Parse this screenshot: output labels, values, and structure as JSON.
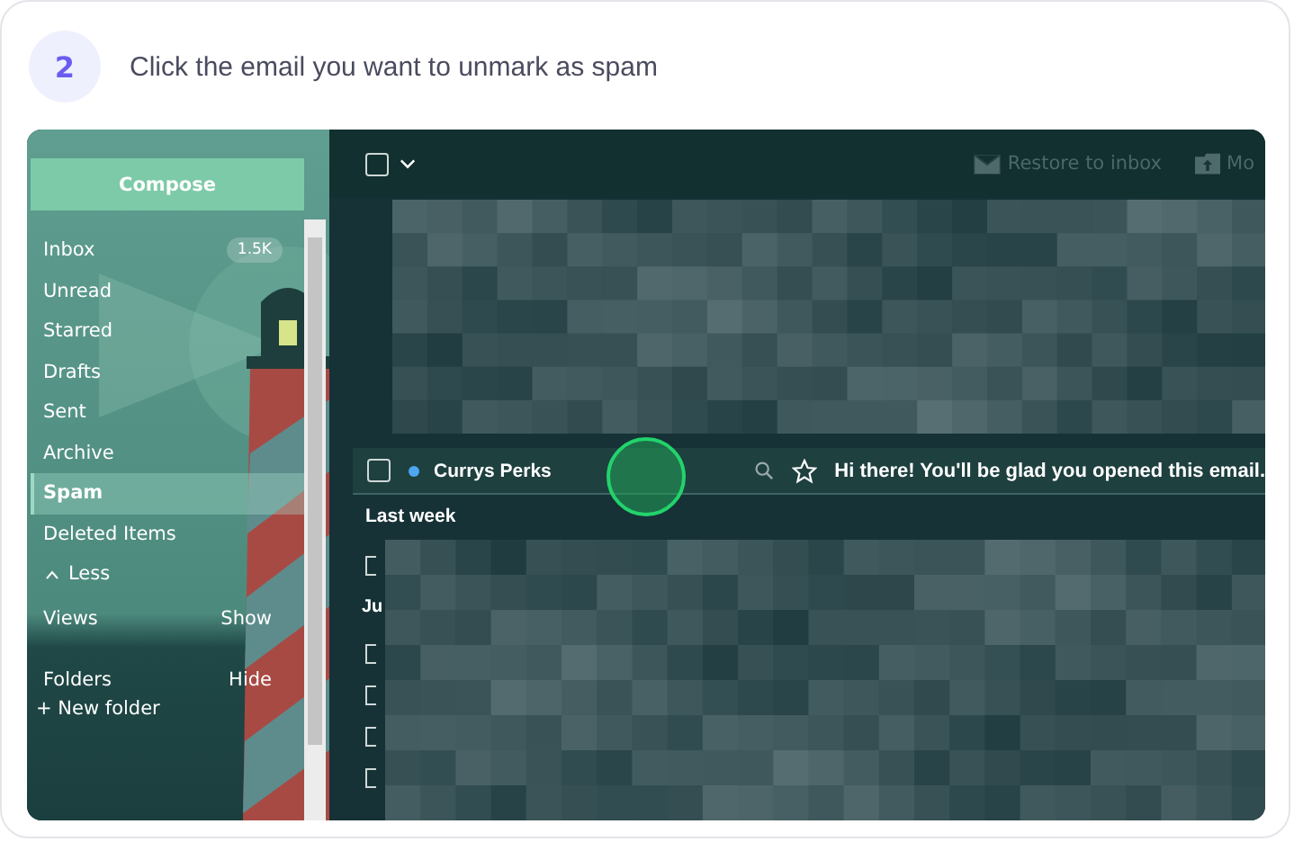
{
  "step": {
    "number": "2",
    "instruction": "Click the email you want to unmark as spam"
  },
  "sidebar": {
    "compose": "Compose",
    "items": [
      {
        "label": "Inbox",
        "badge": "1.5K",
        "selected": false
      },
      {
        "label": "Unread",
        "selected": false
      },
      {
        "label": "Starred",
        "selected": false
      },
      {
        "label": "Drafts",
        "selected": false
      },
      {
        "label": "Sent",
        "selected": false
      },
      {
        "label": "Archive",
        "selected": false
      },
      {
        "label": "Spam",
        "selected": true
      },
      {
        "label": "Deleted Items",
        "selected": false
      }
    ],
    "less": "Less",
    "sections": [
      {
        "label": "Views",
        "action": "Show"
      },
      {
        "label": "Folders",
        "action": "Hide"
      }
    ],
    "new_folder": "+ New folder"
  },
  "toolbar": {
    "select_all": {
      "checked": false
    },
    "actions": [
      {
        "kind": "restore",
        "label": "Restore to inbox"
      },
      {
        "kind": "move",
        "label": "Mo"
      }
    ]
  },
  "emails": [
    {
      "sender": "Currys Perks",
      "unread": true,
      "checked": false,
      "starred": false,
      "subject": "Hi there! You'll be glad you opened this email."
    }
  ],
  "groups": [
    {
      "heading": "Last week"
    },
    {
      "heading": "Ju"
    }
  ],
  "hidden_rows": [
    {
      "checked": false
    },
    {
      "checked": false
    },
    {
      "checked": false
    },
    {
      "checked": false
    },
    {
      "checked": false
    }
  ]
}
